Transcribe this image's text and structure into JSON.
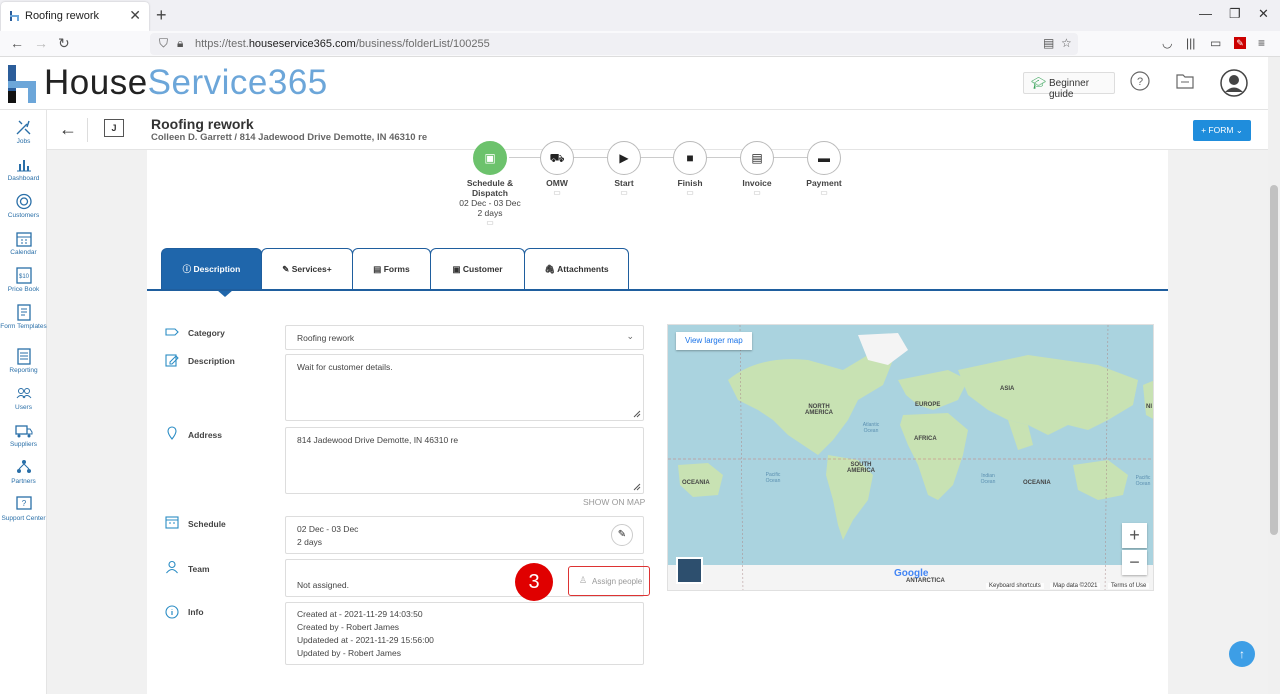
{
  "browser": {
    "tab_title": "Roofing rework",
    "url_prefix": "https://test.",
    "url_domain": "houseservice365.com",
    "url_path": "/business/folderList/100255"
  },
  "header": {
    "logo_part1": "House",
    "logo_part2": "Service365",
    "beginner_guide": "Beginner guide"
  },
  "sidebar": {
    "items": [
      {
        "label": "Jobs",
        "icon": "tools-icon"
      },
      {
        "label": "Dashboard",
        "icon": "chart-icon"
      },
      {
        "label": "Customers",
        "icon": "target-icon"
      },
      {
        "label": "Calendar",
        "icon": "calendar-icon"
      },
      {
        "label": "Price Book",
        "icon": "price-icon"
      },
      {
        "label": "Form Templates",
        "icon": "form-icon"
      },
      {
        "label": "Reporting",
        "icon": "report-icon"
      },
      {
        "label": "Users",
        "icon": "users-icon"
      },
      {
        "label": "Suppliers",
        "icon": "truck-icon"
      },
      {
        "label": "Partners",
        "icon": "partners-icon"
      },
      {
        "label": "Support Center",
        "icon": "help-icon"
      }
    ]
  },
  "job": {
    "badge": "J",
    "title": "Roofing rework",
    "subtitle": "Colleen D. Garrett / 814 Jadewood Drive Demotte, IN 46310 re",
    "form_button": "+ FORM ⌄"
  },
  "steps": [
    {
      "label": "Schedule & Dispatch",
      "meta1": "02 Dec - 03 Dec",
      "meta2": "2 days"
    },
    {
      "label": "OMW"
    },
    {
      "label": "Start"
    },
    {
      "label": "Finish"
    },
    {
      "label": "Invoice"
    },
    {
      "label": "Payment"
    }
  ],
  "tabs": [
    "Description",
    "Services+",
    "Forms",
    "Customer",
    "Attachments"
  ],
  "fields": {
    "category_label": "Category",
    "category_value": "Roofing rework",
    "description_label": "Description",
    "description_value": "Wait for customer details.",
    "address_label": "Address",
    "address_value": "814 Jadewood Drive Demotte, IN 46310 re",
    "show_on_map": "SHOW ON MAP",
    "schedule_label": "Schedule",
    "schedule_dates": "02 Dec - 03 Dec",
    "schedule_duration": "2 days",
    "team_label": "Team",
    "team_value": "Not assigned.",
    "assign_people": "Assign people",
    "info_label": "Info",
    "info_lines": [
      "Created at - 2021-11-29 14:03:50",
      "Created by - Robert James",
      "Updateded at - 2021-11-29 15:56:00",
      "Updated by - Robert James"
    ]
  },
  "annotation_number": "3",
  "map": {
    "view_larger": "View larger map",
    "labels": [
      "NORTH AMERICA",
      "EUROPE",
      "ASIA",
      "AFRICA",
      "SOUTH AMERICA",
      "OCEANIA",
      "OCEANIA",
      "ANTARCTICA",
      "NI"
    ],
    "oceans": [
      "Atlantic Ocean",
      "Pacific Ocean",
      "Indian Ocean",
      "Pacific Ocean"
    ],
    "keyboard": "Keyboard shortcuts",
    "mapdata": "Map data ©2021",
    "terms": "Terms of Use",
    "google": "Google"
  }
}
